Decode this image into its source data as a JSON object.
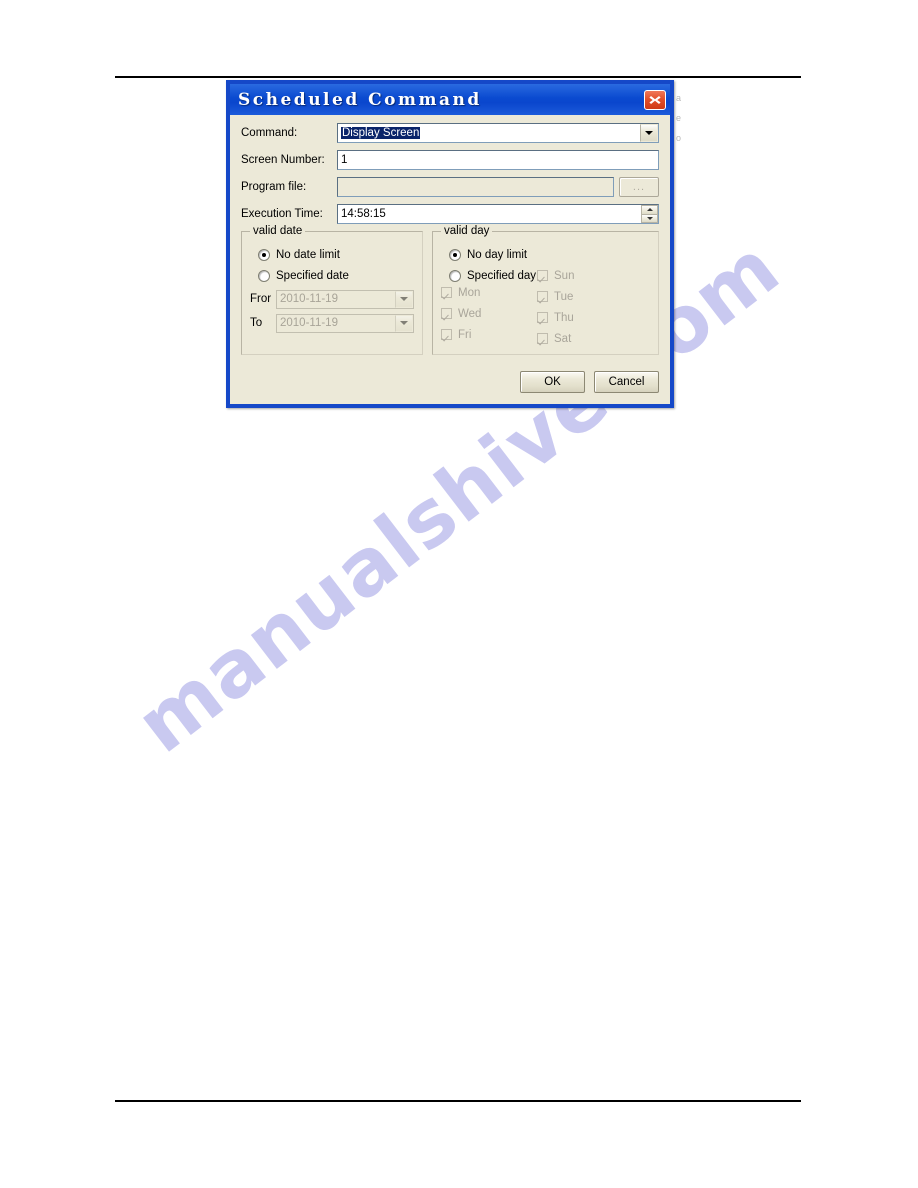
{
  "page": {
    "watermark": "manualshive.com",
    "ghost_fragments": [
      "a",
      "e",
      "o"
    ]
  },
  "dialog": {
    "title": "Scheduled Command",
    "close_label": "Close",
    "fields": [
      {
        "label": "Command:",
        "value": "Display Screen",
        "control": "combobox",
        "selected": true,
        "disabled": false
      },
      {
        "label": "Screen Number:",
        "value": "1",
        "control": "textbox",
        "selected": false,
        "disabled": false
      },
      {
        "label": "Program file:",
        "value": "",
        "control": "textbox-browse",
        "browse_label": "...",
        "selected": false,
        "disabled": true
      },
      {
        "label": "Execution Time:",
        "value": "14:58:15",
        "control": "spinbox",
        "selected": false,
        "disabled": false
      }
    ],
    "valid_date": {
      "title": "valid date",
      "radios": [
        {
          "label": "No date limit",
          "checked": true
        },
        {
          "label": "Specified date",
          "checked": false
        }
      ],
      "from_label": "Fror",
      "from_value": "2010-11-19",
      "to_label": "To",
      "to_value": "2010-11-19",
      "dates_disabled": true
    },
    "valid_day": {
      "title": "valid day",
      "radios": [
        {
          "label": "No day limit",
          "checked": true
        },
        {
          "label": "Specified day",
          "checked": false
        }
      ],
      "days_left": [
        {
          "label": "Mon",
          "checked": true
        },
        {
          "label": "Wed",
          "checked": true
        },
        {
          "label": "Fri",
          "checked": true
        }
      ],
      "days_right": [
        {
          "label": "Sun",
          "checked": true
        },
        {
          "label": "Tue",
          "checked": true
        },
        {
          "label": "Thu",
          "checked": true
        },
        {
          "label": "Sat",
          "checked": true
        }
      ],
      "days_disabled": true
    },
    "buttons": {
      "ok": "OK",
      "cancel": "Cancel"
    }
  },
  "colors": {
    "titlebar_blue": "#0a4ad0",
    "dialog_border": "#1548c8",
    "dialog_face": "#ece9d8",
    "selection_blue": "#0a246a",
    "close_red": "#e2502a",
    "watermark": "#c9c9f0"
  }
}
